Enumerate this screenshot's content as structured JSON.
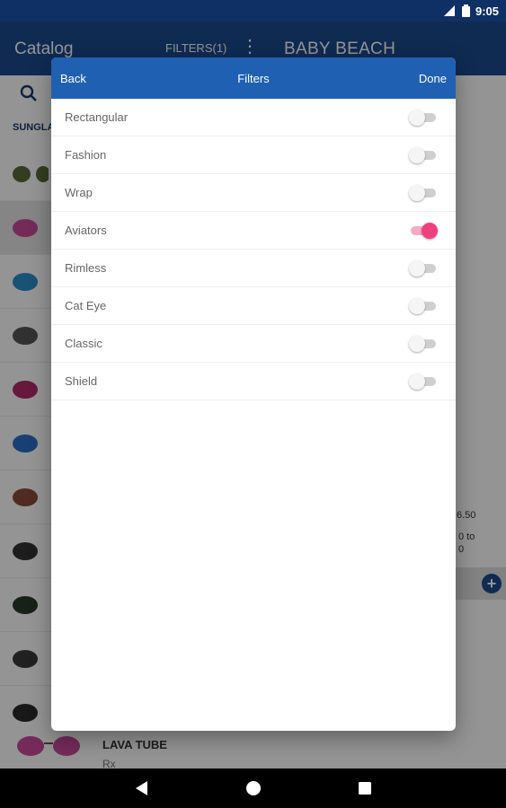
{
  "status_bar": {
    "time": "9:05",
    "network_label": "LTE"
  },
  "app_bar": {
    "title": "Catalog",
    "filters_label": "FILTERS(1)",
    "more_icon": "more-vert-icon",
    "right_title": "BABY BEACH"
  },
  "background": {
    "category_label": "SUNGLA",
    "fragments": {
      "price": "6.50",
      "range_line1": "0 to",
      "range_line2": "0"
    },
    "bottom_product": {
      "name": "LAVA TUBE",
      "sub": "Rx"
    }
  },
  "dialog": {
    "back_label": "Back",
    "title": "Filters",
    "done_label": "Done",
    "filters": [
      {
        "label": "Rectangular",
        "enabled": false
      },
      {
        "label": "Fashion",
        "enabled": false
      },
      {
        "label": "Wrap",
        "enabled": false
      },
      {
        "label": "Aviators",
        "enabled": true
      },
      {
        "label": "Rimless",
        "enabled": false
      },
      {
        "label": "Cat Eye",
        "enabled": false
      },
      {
        "label": "Classic",
        "enabled": false
      },
      {
        "label": "Shield",
        "enabled": false
      }
    ]
  },
  "colors": {
    "status_bar": "#0f3064",
    "app_bar": "#1a4a8e",
    "dialog_header": "#2060b3",
    "switch_on": "#f0417f",
    "switch_on_track": "#f8a9c6"
  }
}
